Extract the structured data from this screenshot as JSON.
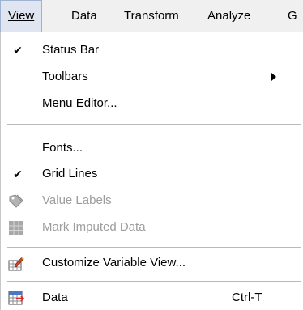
{
  "menubar": {
    "items": [
      {
        "label": "View"
      },
      {
        "label": "Data"
      },
      {
        "label": "Transform"
      },
      {
        "label": "Analyze"
      },
      {
        "label": "G"
      }
    ]
  },
  "view_menu": {
    "items": [
      {
        "label": "Status Bar",
        "checked": true
      },
      {
        "label": "Toolbars",
        "submenu": true
      },
      {
        "label": "Menu Editor..."
      },
      {
        "label": "Fonts..."
      },
      {
        "label": "Grid Lines",
        "checked": true
      },
      {
        "label": "Value Labels",
        "disabled": true,
        "icon": "value-labels-tag-icon"
      },
      {
        "label": "Mark Imputed Data",
        "disabled": true,
        "icon": "grid-table-icon"
      },
      {
        "label": "Customize Variable View...",
        "icon": "customize-view-icon"
      },
      {
        "label": "Data",
        "shortcut": "Ctrl-T",
        "icon": "data-view-icon"
      }
    ]
  },
  "colors": {
    "menubar_bg": "#f0f0f0",
    "active_highlight": "#dfe6f1",
    "disabled_text": "#9d9d9d"
  }
}
